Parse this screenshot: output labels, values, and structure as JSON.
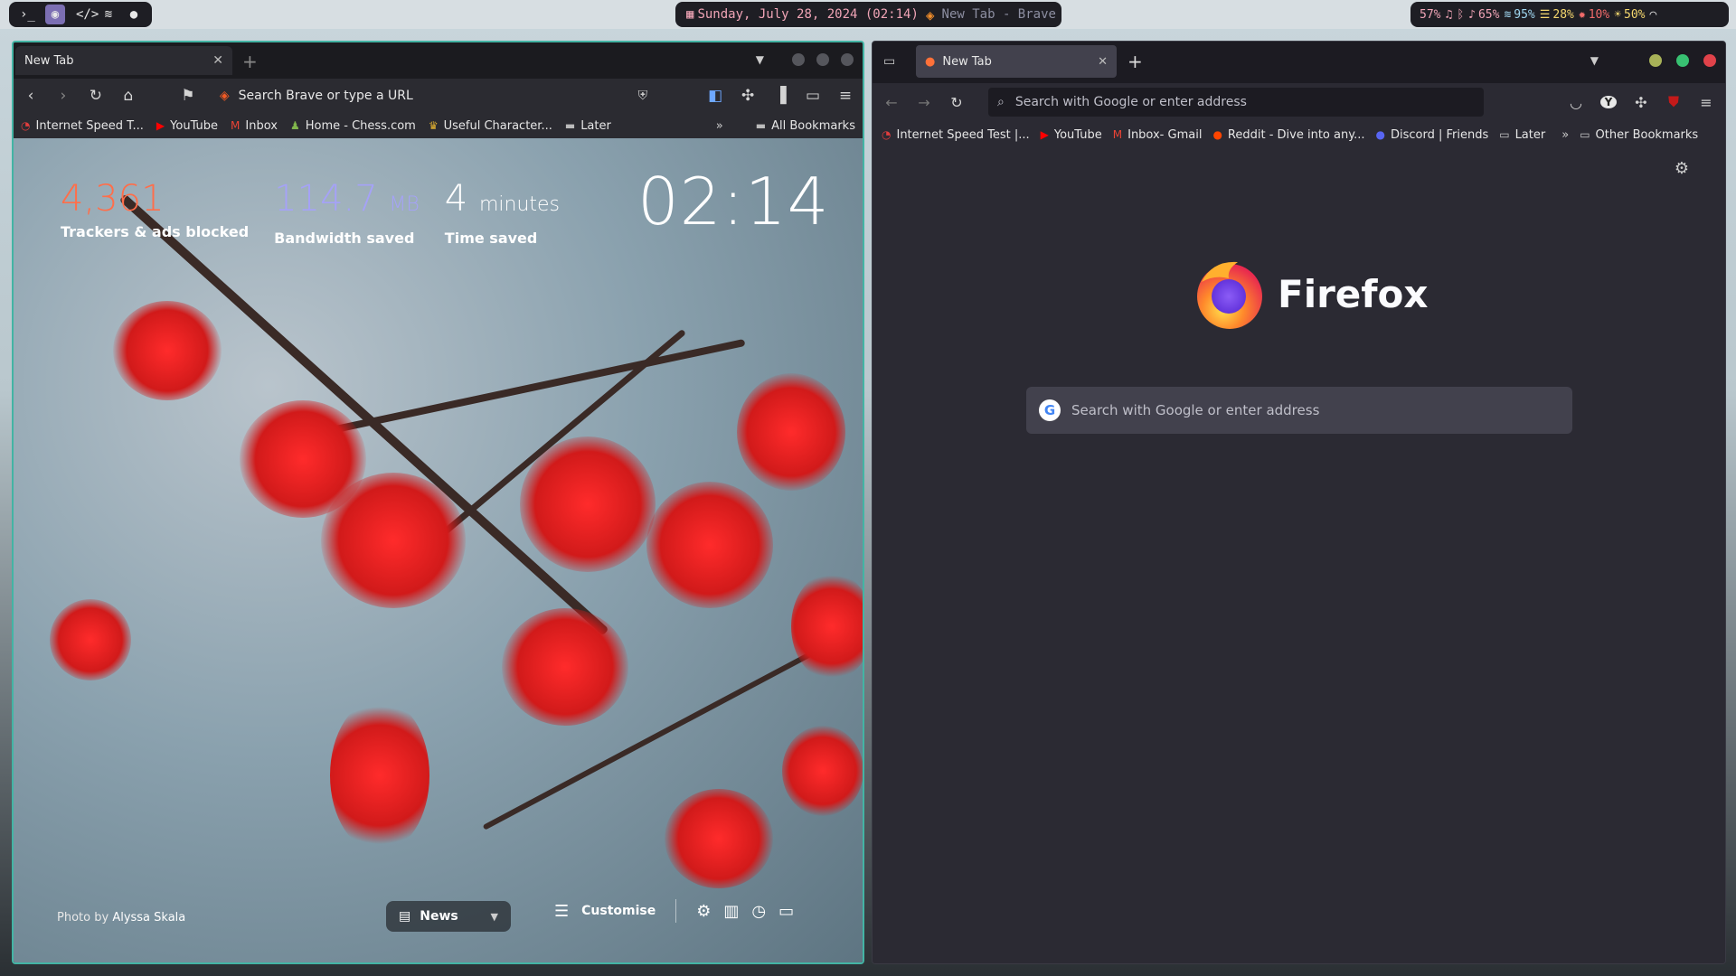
{
  "topbar": {
    "left_icons": [
      "terminal-icon",
      "browser-icon",
      "code-icon",
      "music-icon",
      "chat-icon"
    ],
    "center_date": "Sunday, July 28, 2024 (02:14)",
    "center_title": "New Tab - Brave",
    "status": [
      {
        "name": "cpu",
        "value": "57%",
        "color": "#f0a4b6"
      },
      {
        "name": "headphone",
        "value": "",
        "color": "#f0a4b6"
      },
      {
        "name": "bluetooth",
        "value": "",
        "color": "#f0a4b6"
      },
      {
        "name": "volume",
        "value": "65%",
        "color": "#f0a4b6"
      },
      {
        "name": "wifi",
        "value": "95%",
        "color": "#9fd6f0"
      },
      {
        "name": "memory",
        "value": "28%",
        "color": "#f5d76e"
      },
      {
        "name": "temperature",
        "value": "10%",
        "color": "#f06a6a"
      },
      {
        "name": "brightness",
        "value": "50%",
        "color": "#f5d76e"
      }
    ]
  },
  "brave": {
    "tab_title": "New Tab",
    "url_placeholder": "Search Brave or type a URL",
    "bookmarks": [
      {
        "label": "Internet Speed T...",
        "icon": "speedtest-icon",
        "color": "#e03d3d"
      },
      {
        "label": "YouTube",
        "icon": "youtube-icon",
        "color": "#ff0000"
      },
      {
        "label": "Inbox",
        "icon": "gmail-icon",
        "color": "#ea4335"
      },
      {
        "label": "Home - Chess.com",
        "icon": "chess-icon",
        "color": "#81b64c"
      },
      {
        "label": "Useful Character...",
        "icon": "character-icon",
        "color": "#e0b030"
      },
      {
        "label": "Later",
        "icon": "folder-icon",
        "color": "#bbbbbb"
      }
    ],
    "all_bookmarks": "All Bookmarks",
    "stats": [
      {
        "value": "4,361",
        "unit": "",
        "label": "Trackers & ads blocked",
        "color": "#ff6e4a"
      },
      {
        "value": "114.7",
        "unit": "MB",
        "label": "Bandwidth saved",
        "color": "#a5a2f7"
      },
      {
        "value": "4",
        "unit": "minutes",
        "label": "Time saved",
        "color": "#ffffff"
      }
    ],
    "clock": "02:14",
    "photo_credit_prefix": "Photo by",
    "photo_credit_author": "Alyssa Skala",
    "news_label": "News",
    "customise_label": "Customise"
  },
  "firefox": {
    "tab_title": "New Tab",
    "url_placeholder": "Search with Google or enter address",
    "bookmarks": [
      {
        "label": "Internet Speed Test |...",
        "icon": "speedtest-icon",
        "color": "#e03d3d"
      },
      {
        "label": "YouTube",
        "icon": "youtube-icon",
        "color": "#ff0000"
      },
      {
        "label": "Inbox- Gmail",
        "icon": "gmail-icon",
        "color": "#ea4335"
      },
      {
        "label": "Reddit - Dive into any...",
        "icon": "reddit-icon",
        "color": "#ff4500"
      },
      {
        "label": "Discord | Friends",
        "icon": "discord-icon",
        "color": "#5865f2"
      },
      {
        "label": "Later",
        "icon": "folder-icon",
        "color": "#cccccc"
      }
    ],
    "other_bookmarks": "Other Bookmarks",
    "logo_title": "Firefox",
    "search_placeholder": "Search with Google or enter address"
  }
}
